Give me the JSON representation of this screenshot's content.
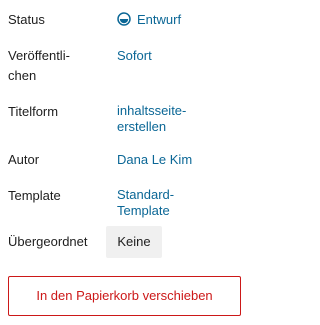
{
  "settings": {
    "status": {
      "label": "Status",
      "value": "Entwurf",
      "icon": "draft-status-icon"
    },
    "publish": {
      "label_line1": "Veröffentli-",
      "label_line2": "chen",
      "value": "Sofort"
    },
    "title_form": {
      "label": "Titelform",
      "value_line1": "inhaltsseite-",
      "value_line2": "erstellen"
    },
    "author": {
      "label": "Autor",
      "value": "Dana Le Kim"
    },
    "template": {
      "label": "Template",
      "value_line1": "Standard-",
      "value_line2": "Template"
    },
    "parent": {
      "label": "Übergeordnet",
      "value": "Keine"
    }
  },
  "trash_button": {
    "label": "In den Papierkorb verschieben"
  },
  "colors": {
    "link": "#0b6796",
    "danger": "#cc1818",
    "text": "#1e1e1e",
    "button_bg": "#f0f0f0"
  }
}
